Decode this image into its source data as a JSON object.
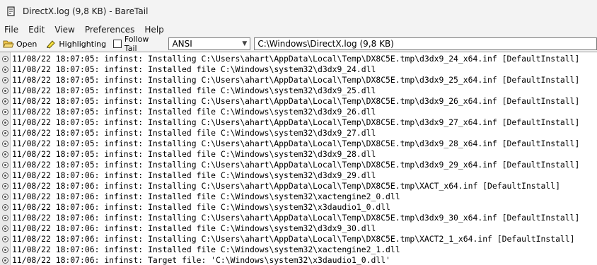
{
  "window": {
    "title": "DirectX.log (9,8 KB) - BareTail",
    "icon": "baretail-app-icon"
  },
  "menu": [
    "File",
    "Edit",
    "View",
    "Preferences",
    "Help"
  ],
  "toolbar": {
    "open_label": "Open",
    "highlighting_label": "Highlighting",
    "follow_tail_label": "Follow Tail",
    "follow_tail_checked": false,
    "encoding_value": "ANSI",
    "file_path": "C:\\Windows\\DirectX.log (9,8 KB)"
  },
  "log_lines": [
    "11/08/22 18:07:05: infinst: Installing C:\\Users\\ahart\\AppData\\Local\\Temp\\DX8C5E.tmp\\d3dx9_24_x64.inf [DefaultInstall]",
    "11/08/22 18:07:05: infinst: Installed file C:\\Windows\\system32\\d3dx9_24.dll",
    "11/08/22 18:07:05: infinst: Installing C:\\Users\\ahart\\AppData\\Local\\Temp\\DX8C5E.tmp\\d3dx9_25_x64.inf [DefaultInstall]",
    "11/08/22 18:07:05: infinst: Installed file C:\\Windows\\system32\\d3dx9_25.dll",
    "11/08/22 18:07:05: infinst: Installing C:\\Users\\ahart\\AppData\\Local\\Temp\\DX8C5E.tmp\\d3dx9_26_x64.inf [DefaultInstall]",
    "11/08/22 18:07:05: infinst: Installed file C:\\Windows\\system32\\d3dx9_26.dll",
    "11/08/22 18:07:05: infinst: Installing C:\\Users\\ahart\\AppData\\Local\\Temp\\DX8C5E.tmp\\d3dx9_27_x64.inf [DefaultInstall]",
    "11/08/22 18:07:05: infinst: Installed file C:\\Windows\\system32\\d3dx9_27.dll",
    "11/08/22 18:07:05: infinst: Installing C:\\Users\\ahart\\AppData\\Local\\Temp\\DX8C5E.tmp\\d3dx9_28_x64.inf [DefaultInstall]",
    "11/08/22 18:07:05: infinst: Installed file C:\\Windows\\system32\\d3dx9_28.dll",
    "11/08/22 18:07:05: infinst: Installing C:\\Users\\ahart\\AppData\\Local\\Temp\\DX8C5E.tmp\\d3dx9_29_x64.inf [DefaultInstall]",
    "11/08/22 18:07:06: infinst: Installed file C:\\Windows\\system32\\d3dx9_29.dll",
    "11/08/22 18:07:06: infinst: Installing C:\\Users\\ahart\\AppData\\Local\\Temp\\DX8C5E.tmp\\XACT_x64.inf [DefaultInstall]",
    "11/08/22 18:07:06: infinst: Installed file C:\\Windows\\system32\\xactengine2_0.dll",
    "11/08/22 18:07:06: infinst: Installed file C:\\Windows\\system32\\x3daudio1_0.dll",
    "11/08/22 18:07:06: infinst: Installing C:\\Users\\ahart\\AppData\\Local\\Temp\\DX8C5E.tmp\\d3dx9_30_x64.inf [DefaultInstall]",
    "11/08/22 18:07:06: infinst: Installed file C:\\Windows\\system32\\d3dx9_30.dll",
    "11/08/22 18:07:06: infinst: Installing C:\\Users\\ahart\\AppData\\Local\\Temp\\DX8C5E.tmp\\XACT2_1_x64.inf [DefaultInstall]",
    "11/08/22 18:07:06: infinst: Installed file C:\\Windows\\system32\\xactengine2_1.dll",
    "11/08/22 18:07:06: infinst: Target file: 'C:\\Windows\\system32\\x3daudio1_0.dll'"
  ]
}
